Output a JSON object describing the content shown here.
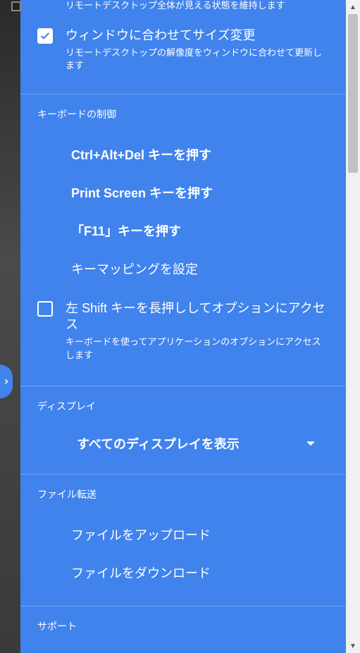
{
  "top": {
    "partial_desc": "リモートデスクトップ全体が見える状態を維持します",
    "resize_title": "ウィンドウに合わせてサイズ変更",
    "resize_desc": "リモートデスクトップの解像度をウィンドウに合わせて更新します"
  },
  "keyboard": {
    "title": "キーボードの制御",
    "ctrl_alt_del": "Ctrl+Alt+Del キーを押す",
    "print_screen": "Print Screen キーを押す",
    "f11": "「F11」キーを押す",
    "keymap": "キーマッピングを設定",
    "shift_title": "左 Shift キーを長押ししてオプションにアクセス",
    "shift_desc": "キーボードを使ってアプリケーションのオプションにアクセスします"
  },
  "display": {
    "title": "ディスプレイ",
    "show_all": "すべてのディスプレイを表示"
  },
  "file": {
    "title": "ファイル転送",
    "upload": "ファイルをアップロード",
    "download": "ファイルをダウンロード"
  },
  "support": {
    "title": "サポート"
  }
}
